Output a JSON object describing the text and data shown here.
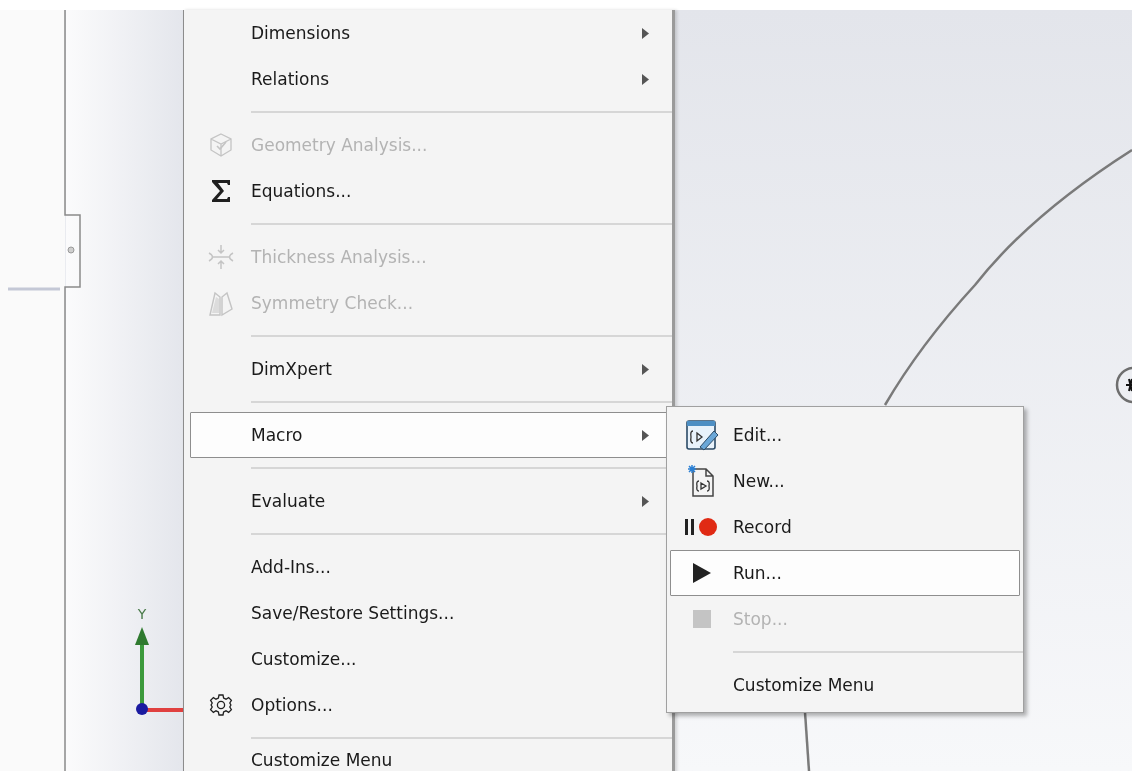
{
  "viewport": {
    "axis_label": "Y"
  },
  "menu": {
    "items": [
      {
        "kind": "item",
        "label": "Dimensions",
        "disabled": false,
        "has_submenu": true,
        "selected": false
      },
      {
        "kind": "item",
        "label": "Relations",
        "disabled": false,
        "has_submenu": true,
        "selected": false
      },
      {
        "kind": "separator"
      },
      {
        "kind": "item",
        "label": "Geometry Analysis...",
        "disabled": true,
        "has_submenu": false,
        "selected": false
      },
      {
        "kind": "item",
        "label": "Equations...",
        "disabled": false,
        "has_submenu": false,
        "selected": false
      },
      {
        "kind": "separator"
      },
      {
        "kind": "item",
        "label": "Thickness Analysis...",
        "disabled": true,
        "has_submenu": false,
        "selected": false
      },
      {
        "kind": "item",
        "label": "Symmetry Check...",
        "disabled": true,
        "has_submenu": false,
        "selected": false
      },
      {
        "kind": "separator"
      },
      {
        "kind": "item",
        "label": "DimXpert",
        "disabled": false,
        "has_submenu": true,
        "selected": false
      },
      {
        "kind": "separator"
      },
      {
        "kind": "item",
        "label": "Macro",
        "disabled": false,
        "has_submenu": true,
        "selected": true
      },
      {
        "kind": "separator"
      },
      {
        "kind": "item",
        "label": "Evaluate",
        "disabled": false,
        "has_submenu": true,
        "selected": false
      },
      {
        "kind": "separator"
      },
      {
        "kind": "item",
        "label": "Add-Ins...",
        "disabled": false,
        "has_submenu": false,
        "selected": false
      },
      {
        "kind": "item",
        "label": "Save/Restore Settings...",
        "disabled": false,
        "has_submenu": false,
        "selected": false
      },
      {
        "kind": "item",
        "label": "Customize...",
        "disabled": false,
        "has_submenu": false,
        "selected": false
      },
      {
        "kind": "item",
        "label": "Options...",
        "disabled": false,
        "has_submenu": false,
        "selected": false
      },
      {
        "kind": "separator"
      },
      {
        "kind": "item",
        "label": "Customize Menu",
        "disabled": false,
        "has_submenu": false,
        "selected": false
      }
    ]
  },
  "submenu": {
    "items": [
      {
        "kind": "item",
        "label": "Edit...",
        "disabled": false,
        "selected": false
      },
      {
        "kind": "item",
        "label": "New...",
        "disabled": false,
        "selected": false
      },
      {
        "kind": "item",
        "label": "Record",
        "disabled": false,
        "selected": false
      },
      {
        "kind": "item",
        "label": "Run...",
        "disabled": false,
        "selected": true
      },
      {
        "kind": "item",
        "label": "Stop...",
        "disabled": true,
        "selected": false
      },
      {
        "kind": "separator"
      },
      {
        "kind": "item",
        "label": "Customize Menu",
        "disabled": false,
        "selected": false
      }
    ]
  }
}
